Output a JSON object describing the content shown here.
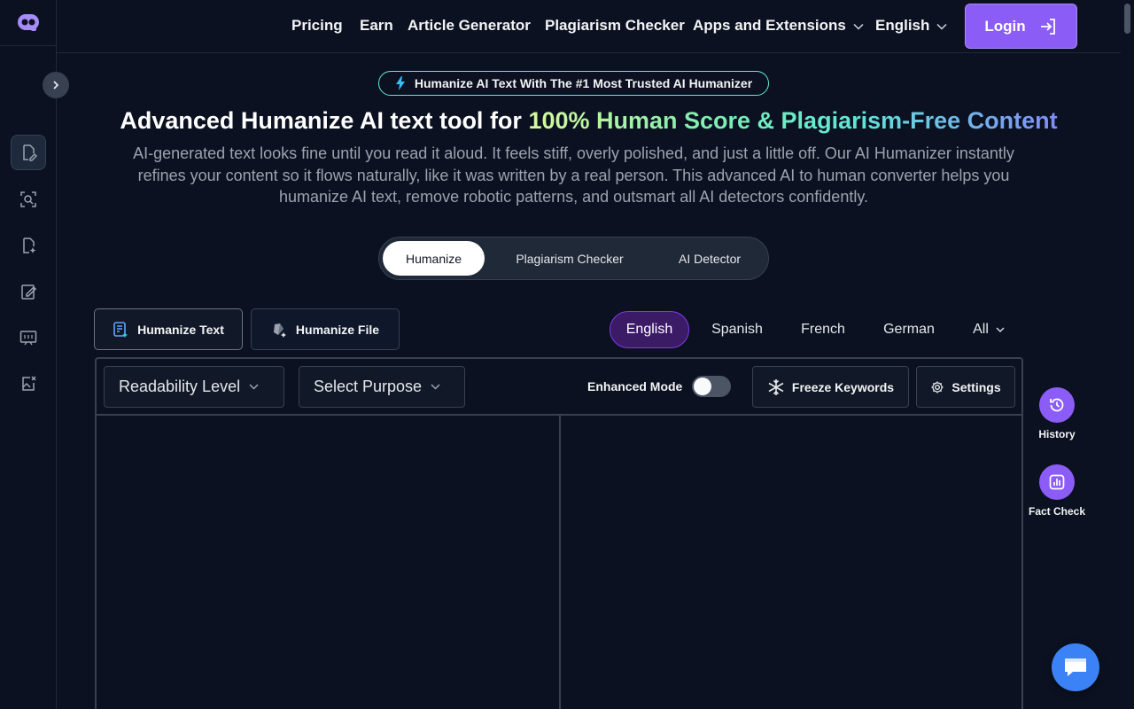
{
  "nav": {
    "links": [
      "Pricing",
      "Earn",
      "Article Generator",
      "Plagiarism Checker"
    ],
    "apps_label": "Apps and Extensions",
    "language_label": "English",
    "login_label": "Login"
  },
  "hero": {
    "badge": "Humanize AI Text With The #1 Most Trusted AI Humanizer",
    "headline_plain": "Advanced Humanize AI text tool for ",
    "headline_highlight": "100% Human Score & Plagiarism-Free Content",
    "subtext": "AI-generated text looks fine until you read it aloud. It feels stiff, overly polished, and just a little off. Our AI Humanizer instantly refines your content so it flows naturally, like it was written by a real person. This advanced AI to human converter helps you humanize AI text, remove robotic patterns, and outsmart all AI detectors confidently."
  },
  "mode_tabs": [
    {
      "label": "Humanize",
      "active": true
    },
    {
      "label": "Plagiarism Checker",
      "active": false
    },
    {
      "label": "AI Detector",
      "active": false
    }
  ],
  "source_buttons": {
    "text_label": "Humanize Text",
    "file_label": "Humanize File"
  },
  "languages": {
    "items": [
      "English",
      "Spanish",
      "French",
      "German"
    ],
    "active": "English",
    "all_label": "All"
  },
  "editor": {
    "readability_label": "Readability Level",
    "purpose_label": "Select Purpose",
    "enhanced_mode_label": "Enhanced Mode",
    "enhanced_mode_on": false,
    "freeze_keywords_label": "Freeze Keywords",
    "settings_label": "Settings"
  },
  "side_actions": {
    "history_label": "History",
    "fact_check_label": "Fact Check"
  },
  "colors": {
    "background": "#0b1120",
    "accent": "#8b5cf6",
    "chat": "#3b82f6"
  }
}
